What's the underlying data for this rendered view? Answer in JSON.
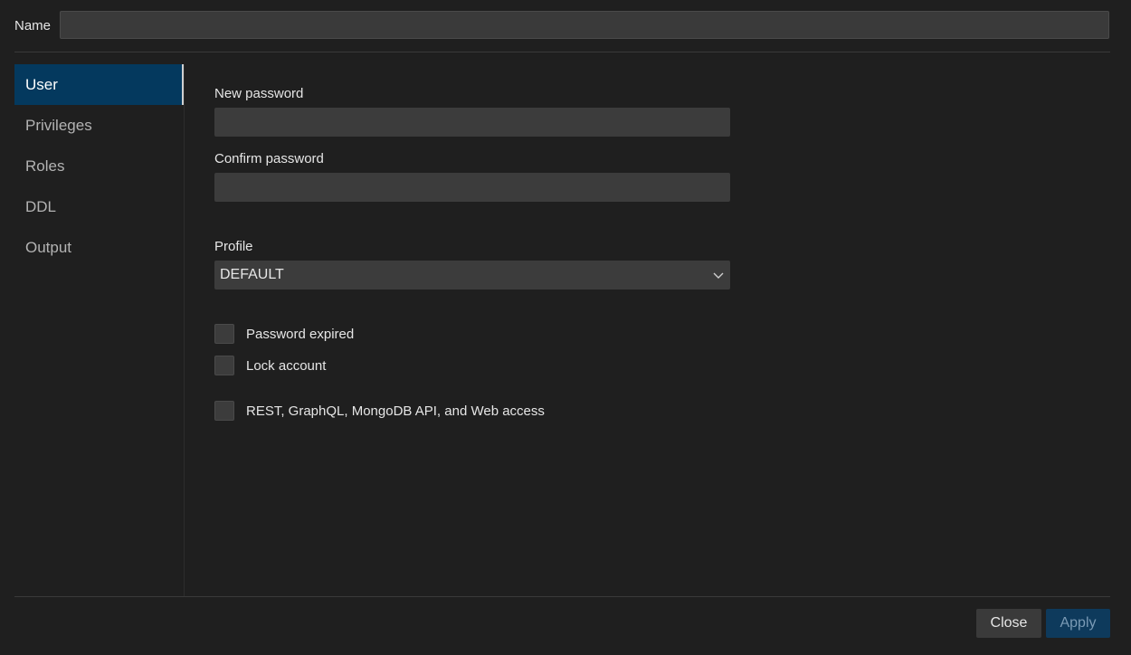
{
  "header": {
    "name_label": "Name",
    "name_value": ""
  },
  "sidebar": {
    "items": [
      {
        "label": "User",
        "active": true
      },
      {
        "label": "Privileges",
        "active": false
      },
      {
        "label": "Roles",
        "active": false
      },
      {
        "label": "DDL",
        "active": false
      },
      {
        "label": "Output",
        "active": false
      }
    ]
  },
  "form": {
    "new_password_label": "New password",
    "confirm_password_label": "Confirm password",
    "profile_label": "Profile",
    "profile_value": "DEFAULT",
    "checkboxes": [
      {
        "label": "Password expired",
        "checked": false
      },
      {
        "label": "Lock account",
        "checked": false
      },
      {
        "label": "REST, GraphQL, MongoDB API, and Web access",
        "checked": false
      }
    ]
  },
  "footer": {
    "close_label": "Close",
    "apply_label": "Apply"
  },
  "colors": {
    "background": "#1f1f1f",
    "active_item": "#04395e",
    "apply_button": "#0e3a5c",
    "input_bg": "#3c3c3c"
  },
  "icons": {
    "profile_dropdown": "chevron-down-icon"
  }
}
